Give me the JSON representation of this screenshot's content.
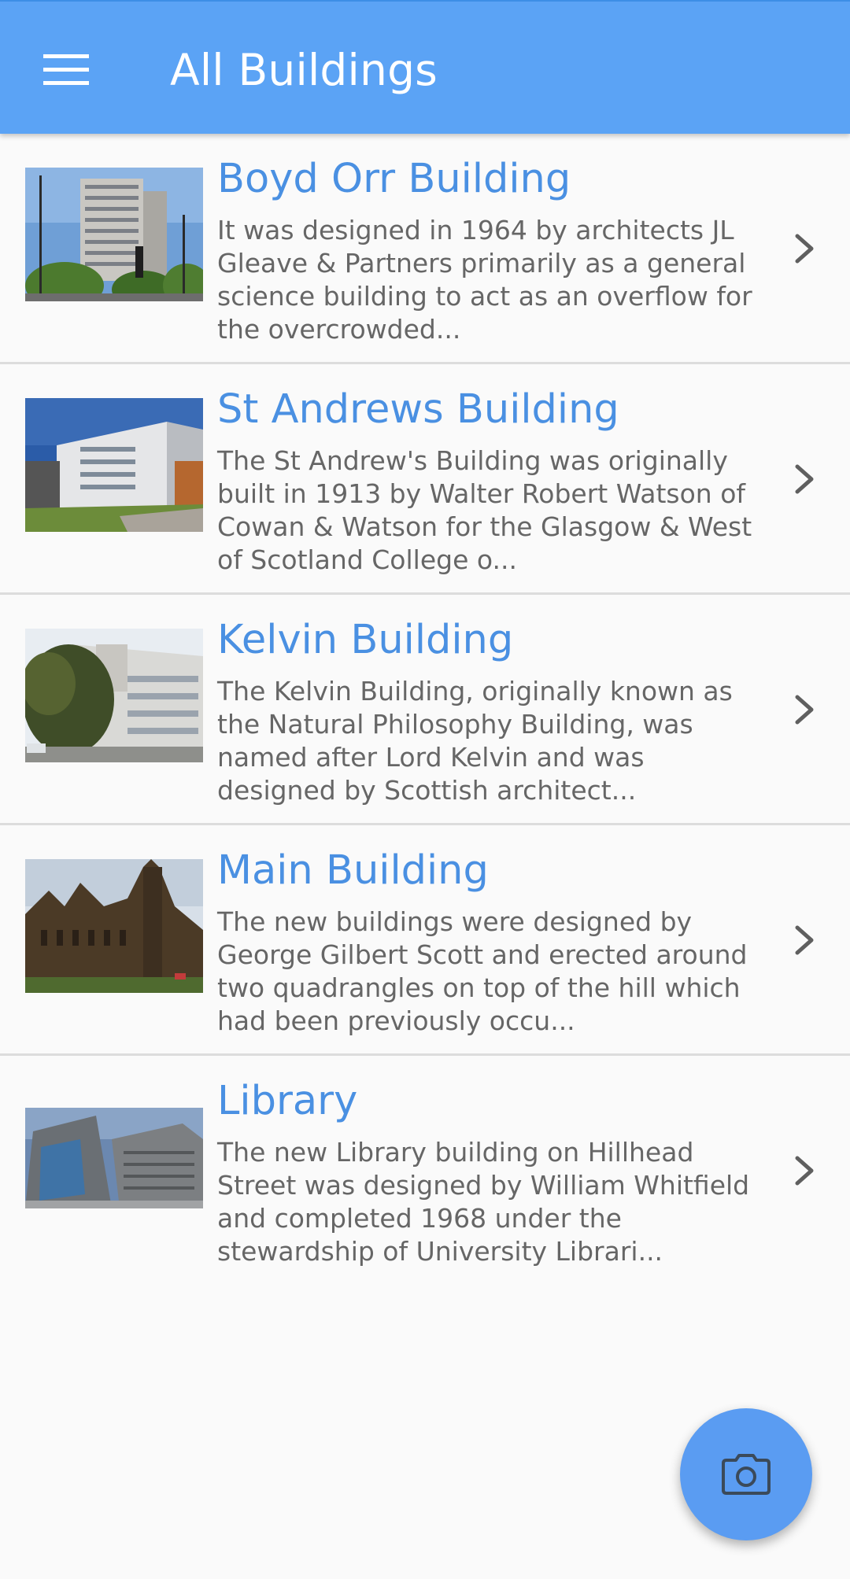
{
  "app_bar": {
    "title": "All Buildings",
    "menu_icon": "hamburger-menu-icon",
    "background_color": "#5ba3f5"
  },
  "buildings": [
    {
      "title": "Boyd Orr Building",
      "description": "It was designed in 1964 by architects JL Gleave & Partners primarily as a general science building to act as an overflow for the overcrowded...",
      "photo": "boyd-orr-building-photo",
      "chevron_icon": "chevron-right-icon"
    },
    {
      "title": "St Andrews Building",
      "description": "The St Andrew's Building was originally built in 1913 by Walter Robert Watson of Cowan & Watson for the Glasgow & West of Scotland College o...",
      "photo": "st-andrews-building-photo",
      "chevron_icon": "chevron-right-icon"
    },
    {
      "title": "Kelvin Building",
      "description": "The Kelvin Building, originally known as the Natural Philosophy Building, was named after Lord Kelvin and was designed by Scottish architect...",
      "photo": "kelvin-building-photo",
      "chevron_icon": "chevron-right-icon"
    },
    {
      "title": "Main Building",
      "description": "The new buildings were designed by George Gilbert Scott and erected around two quadrangles on top of the hill which had been previously occu...",
      "photo": "main-building-photo",
      "chevron_icon": "chevron-right-icon"
    },
    {
      "title": "Library",
      "description": "The new Library building on Hillhead Street was designed by William Whitfield and completed 1968 under the stewardship of University Librari...",
      "photo": "library-building-photo",
      "chevron_icon": "chevron-right-icon"
    }
  ],
  "fab": {
    "icon": "camera-icon",
    "color": "#5a9cf2"
  },
  "colors": {
    "title_text": "#4a90e2",
    "description_text": "#666666",
    "divider": "#dcdcdc"
  }
}
